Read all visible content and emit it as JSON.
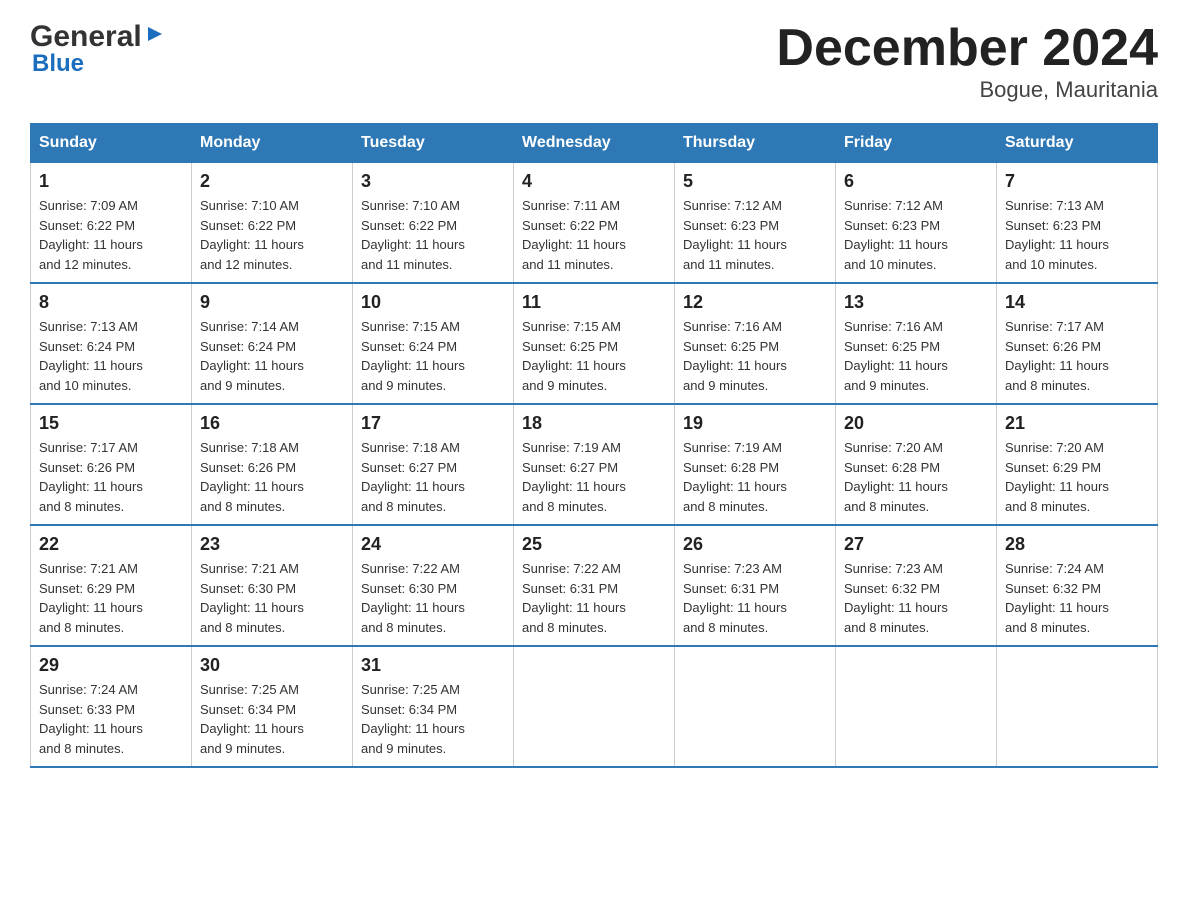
{
  "logo": {
    "general": "General",
    "blue": "Blue",
    "arrow": "▶"
  },
  "header": {
    "month_year": "December 2024",
    "location": "Bogue, Mauritania"
  },
  "weekdays": [
    "Sunday",
    "Monday",
    "Tuesday",
    "Wednesday",
    "Thursday",
    "Friday",
    "Saturday"
  ],
  "weeks": [
    [
      {
        "day": "1",
        "sunrise": "7:09 AM",
        "sunset": "6:22 PM",
        "daylight": "11 hours and 12 minutes."
      },
      {
        "day": "2",
        "sunrise": "7:10 AM",
        "sunset": "6:22 PM",
        "daylight": "11 hours and 12 minutes."
      },
      {
        "day": "3",
        "sunrise": "7:10 AM",
        "sunset": "6:22 PM",
        "daylight": "11 hours and 11 minutes."
      },
      {
        "day": "4",
        "sunrise": "7:11 AM",
        "sunset": "6:22 PM",
        "daylight": "11 hours and 11 minutes."
      },
      {
        "day": "5",
        "sunrise": "7:12 AM",
        "sunset": "6:23 PM",
        "daylight": "11 hours and 11 minutes."
      },
      {
        "day": "6",
        "sunrise": "7:12 AM",
        "sunset": "6:23 PM",
        "daylight": "11 hours and 10 minutes."
      },
      {
        "day": "7",
        "sunrise": "7:13 AM",
        "sunset": "6:23 PM",
        "daylight": "11 hours and 10 minutes."
      }
    ],
    [
      {
        "day": "8",
        "sunrise": "7:13 AM",
        "sunset": "6:24 PM",
        "daylight": "11 hours and 10 minutes."
      },
      {
        "day": "9",
        "sunrise": "7:14 AM",
        "sunset": "6:24 PM",
        "daylight": "11 hours and 9 minutes."
      },
      {
        "day": "10",
        "sunrise": "7:15 AM",
        "sunset": "6:24 PM",
        "daylight": "11 hours and 9 minutes."
      },
      {
        "day": "11",
        "sunrise": "7:15 AM",
        "sunset": "6:25 PM",
        "daylight": "11 hours and 9 minutes."
      },
      {
        "day": "12",
        "sunrise": "7:16 AM",
        "sunset": "6:25 PM",
        "daylight": "11 hours and 9 minutes."
      },
      {
        "day": "13",
        "sunrise": "7:16 AM",
        "sunset": "6:25 PM",
        "daylight": "11 hours and 9 minutes."
      },
      {
        "day": "14",
        "sunrise": "7:17 AM",
        "sunset": "6:26 PM",
        "daylight": "11 hours and 8 minutes."
      }
    ],
    [
      {
        "day": "15",
        "sunrise": "7:17 AM",
        "sunset": "6:26 PM",
        "daylight": "11 hours and 8 minutes."
      },
      {
        "day": "16",
        "sunrise": "7:18 AM",
        "sunset": "6:26 PM",
        "daylight": "11 hours and 8 minutes."
      },
      {
        "day": "17",
        "sunrise": "7:18 AM",
        "sunset": "6:27 PM",
        "daylight": "11 hours and 8 minutes."
      },
      {
        "day": "18",
        "sunrise": "7:19 AM",
        "sunset": "6:27 PM",
        "daylight": "11 hours and 8 minutes."
      },
      {
        "day": "19",
        "sunrise": "7:19 AM",
        "sunset": "6:28 PM",
        "daylight": "11 hours and 8 minutes."
      },
      {
        "day": "20",
        "sunrise": "7:20 AM",
        "sunset": "6:28 PM",
        "daylight": "11 hours and 8 minutes."
      },
      {
        "day": "21",
        "sunrise": "7:20 AM",
        "sunset": "6:29 PM",
        "daylight": "11 hours and 8 minutes."
      }
    ],
    [
      {
        "day": "22",
        "sunrise": "7:21 AM",
        "sunset": "6:29 PM",
        "daylight": "11 hours and 8 minutes."
      },
      {
        "day": "23",
        "sunrise": "7:21 AM",
        "sunset": "6:30 PM",
        "daylight": "11 hours and 8 minutes."
      },
      {
        "day": "24",
        "sunrise": "7:22 AM",
        "sunset": "6:30 PM",
        "daylight": "11 hours and 8 minutes."
      },
      {
        "day": "25",
        "sunrise": "7:22 AM",
        "sunset": "6:31 PM",
        "daylight": "11 hours and 8 minutes."
      },
      {
        "day": "26",
        "sunrise": "7:23 AM",
        "sunset": "6:31 PM",
        "daylight": "11 hours and 8 minutes."
      },
      {
        "day": "27",
        "sunrise": "7:23 AM",
        "sunset": "6:32 PM",
        "daylight": "11 hours and 8 minutes."
      },
      {
        "day": "28",
        "sunrise": "7:24 AM",
        "sunset": "6:32 PM",
        "daylight": "11 hours and 8 minutes."
      }
    ],
    [
      {
        "day": "29",
        "sunrise": "7:24 AM",
        "sunset": "6:33 PM",
        "daylight": "11 hours and 8 minutes."
      },
      {
        "day": "30",
        "sunrise": "7:25 AM",
        "sunset": "6:34 PM",
        "daylight": "11 hours and 9 minutes."
      },
      {
        "day": "31",
        "sunrise": "7:25 AM",
        "sunset": "6:34 PM",
        "daylight": "11 hours and 9 minutes."
      },
      null,
      null,
      null,
      null
    ]
  ],
  "labels": {
    "sunrise": "Sunrise:",
    "sunset": "Sunset:",
    "daylight": "Daylight:"
  }
}
